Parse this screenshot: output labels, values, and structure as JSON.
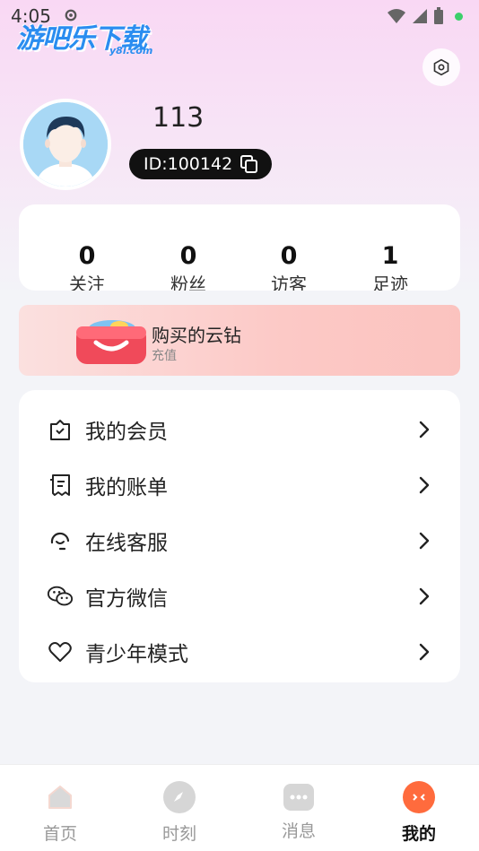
{
  "status_bar": {
    "time": "4:05"
  },
  "watermark": {
    "brand": "游吧乐下载",
    "domain": "y8l.com"
  },
  "profile": {
    "username": "113",
    "id_label": "ID:100142"
  },
  "stats": [
    {
      "value": "0",
      "label": "关注"
    },
    {
      "value": "0",
      "label": "粉丝"
    },
    {
      "value": "0",
      "label": "访客"
    },
    {
      "value": "1",
      "label": "足迹"
    }
  ],
  "banner": {
    "title": "购买的云钻",
    "subtitle": "充值"
  },
  "menu": [
    {
      "label": "我的会员",
      "icon": "vip-bag-icon"
    },
    {
      "label": "我的账单",
      "icon": "bill-icon"
    },
    {
      "label": "在线客服",
      "icon": "customer-service-icon"
    },
    {
      "label": "官方微信",
      "icon": "wechat-icon"
    },
    {
      "label": "青少年模式",
      "icon": "heart-icon"
    }
  ],
  "tabs": [
    {
      "label": "首页",
      "icon": "home-icon"
    },
    {
      "label": "时刻",
      "icon": "compass-icon"
    },
    {
      "label": "消息",
      "icon": "message-icon"
    },
    {
      "label": "我的",
      "icon": "profile-face-icon",
      "active": true
    }
  ],
  "colors": {
    "accent": "#ff6b3d",
    "pill": "#111111",
    "banner": "#fcc9c6"
  }
}
